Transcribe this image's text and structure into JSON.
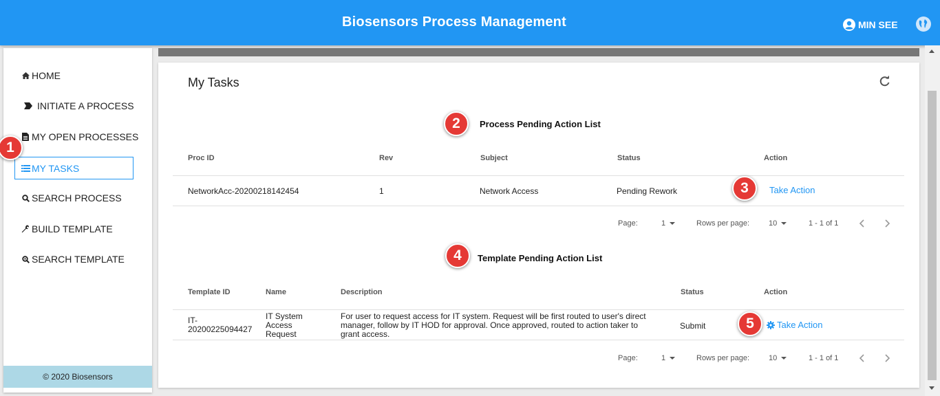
{
  "header": {
    "title": "Biosensors Process Management",
    "user": "MIN SEE"
  },
  "sidebar": {
    "items": [
      {
        "label": "HOME",
        "icon": "home-icon"
      },
      {
        "label": "INITIATE A PROCESS",
        "icon": "arrow-tag-icon"
      },
      {
        "label": "MY OPEN PROCESSES",
        "icon": "document-icon"
      },
      {
        "label": "MY TASKS",
        "icon": "list-icon",
        "active": true
      },
      {
        "label": "SEARCH PROCESS",
        "icon": "search-icon"
      },
      {
        "label": "BUILD TEMPLATE",
        "icon": "wrench-icon"
      },
      {
        "label": "SEARCH TEMPLATE",
        "icon": "search-zoom-icon"
      }
    ],
    "footer": "© 2020 Biosensors"
  },
  "main": {
    "title": "My Tasks",
    "process_list": {
      "title": "Process Pending Action List",
      "headers": [
        "Proc ID",
        "Rev",
        "Subject",
        "Status",
        "Action"
      ],
      "rows": [
        {
          "proc_id": "NetworkAcc-20200218142454",
          "rev": "1",
          "subject": "Network Access",
          "status": "Pending Rework",
          "action": "Take Action"
        }
      ],
      "pagination": {
        "page_label": "Page:",
        "page": "1",
        "rows_label": "Rows per page:",
        "rows": "10",
        "range": "1 - 1 of 1"
      }
    },
    "template_list": {
      "title": "Template Pending Action List",
      "headers": [
        "Template ID",
        "Name",
        "Description",
        "Status",
        "Action"
      ],
      "rows": [
        {
          "template_id_line1": "IT-",
          "template_id_line2": "20200225094427",
          "name_line1": "IT System",
          "name_line2": "Access",
          "name_line3": "Request",
          "desc_line1": "For user to request access for IT system. Request will be first routed to user's direct",
          "desc_line2": "manager, follow by IT HOD for approval. Once approved, routed to action taker to",
          "desc_line3": "grant access.",
          "status": "Submit",
          "action": "Take Action"
        }
      ],
      "pagination": {
        "page_label": "Page:",
        "page": "1",
        "rows_label": "Rows per page:",
        "rows": "10",
        "range": "1 - 1 of 1"
      }
    }
  },
  "callouts": [
    "1",
    "2",
    "3",
    "4",
    "5"
  ],
  "colors": {
    "primary": "#2196f3",
    "callout": "#e53935",
    "footer": "#add8e6"
  }
}
